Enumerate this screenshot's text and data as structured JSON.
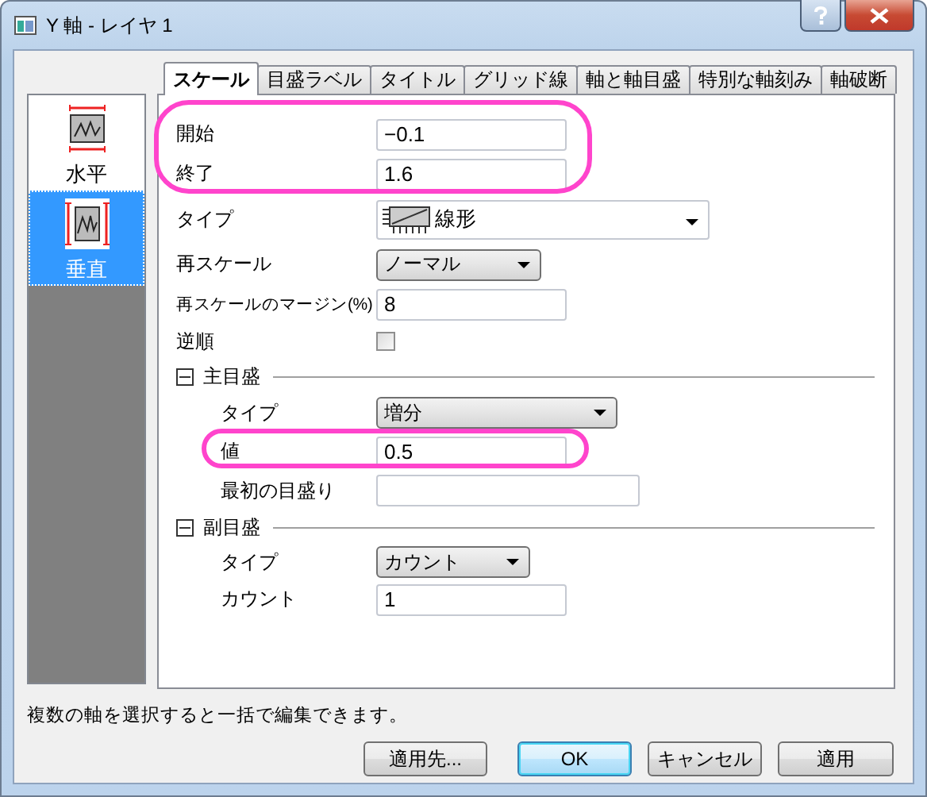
{
  "window": {
    "title": "Y 軸 - レイヤ 1"
  },
  "sidebar": {
    "items": [
      {
        "kind": "horizontal",
        "label": "水平",
        "selected": false
      },
      {
        "kind": "vertical",
        "label": "垂直",
        "selected": true
      }
    ]
  },
  "tabs": [
    {
      "label": "スケール",
      "selected": true
    },
    {
      "label": "目盛ラベル",
      "selected": false
    },
    {
      "label": "タイトル",
      "selected": false
    },
    {
      "label": "グリッド線",
      "selected": false
    },
    {
      "label": "軸と軸目盛",
      "selected": false
    },
    {
      "label": "特別な軸刻み",
      "selected": false
    },
    {
      "label": "軸破断",
      "selected": false
    }
  ],
  "scale": {
    "range": {
      "highlighted": true,
      "start": {
        "label": "開始",
        "value": "−0.1"
      },
      "end": {
        "label": "終了",
        "value": "1.6"
      }
    },
    "type": {
      "label": "タイプ",
      "value": "線形"
    },
    "rescale": {
      "label": "再スケール",
      "value": "ノーマル"
    },
    "rescale_margin": {
      "label": "再スケールのマージン(%)",
      "value": "8"
    },
    "reverse": {
      "label": "逆順",
      "checked": false
    },
    "major_ticks": {
      "label": "主目盛",
      "expanded": true,
      "type": {
        "label": "タイプ",
        "value": "増分"
      },
      "value": {
        "label": "値",
        "value": "0.5",
        "highlighted": true
      },
      "first_tick": {
        "label": "最初の目盛り"
      }
    },
    "minor_ticks": {
      "label": "副目盛",
      "expanded": true,
      "type": {
        "label": "タイプ",
        "value": "カウント"
      },
      "count": {
        "label": "カウント",
        "value": "1"
      }
    }
  },
  "hint": "複数の軸を選択すると一括で編集できます。",
  "buttons": [
    {
      "label": "適用先...",
      "default": false
    },
    {
      "label": "OK",
      "default": true
    },
    {
      "label": "キャンセル",
      "default": false
    },
    {
      "label": "適用",
      "default": false
    }
  ]
}
